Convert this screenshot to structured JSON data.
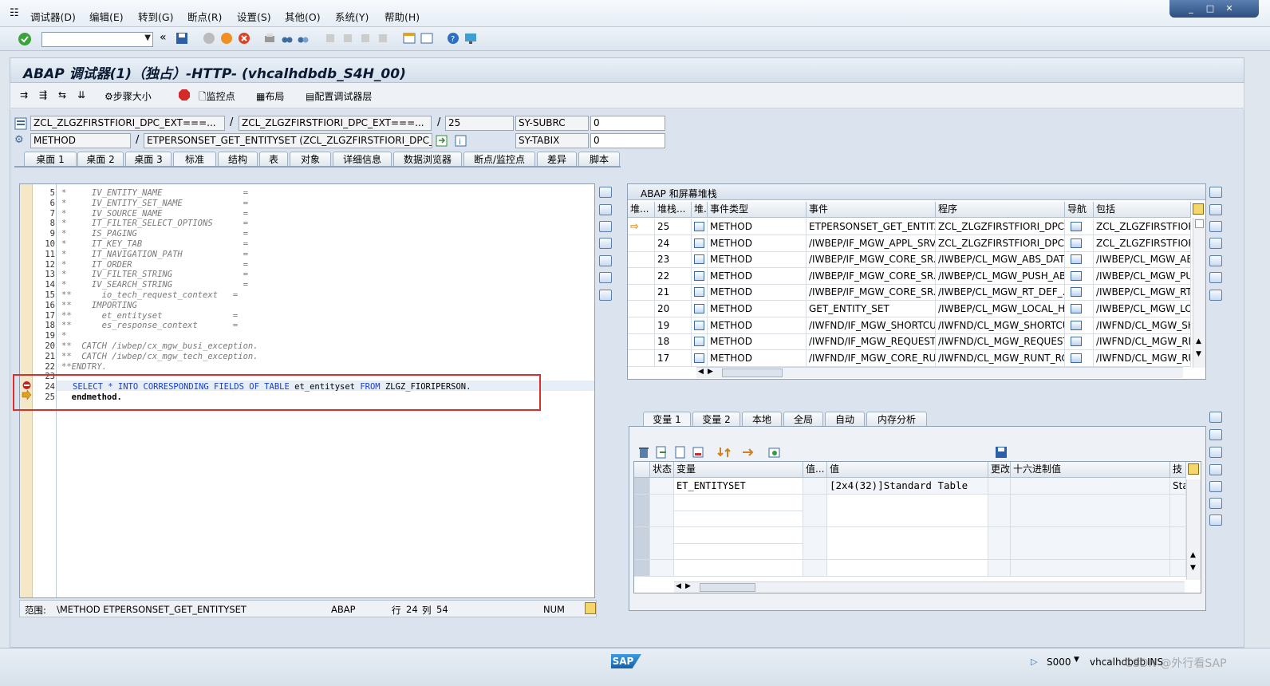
{
  "menu": [
    "调试器(D)",
    "编辑(E)",
    "转到(G)",
    "断点(R)",
    "设置(S)",
    "其他(O)",
    "系统(Y)",
    "帮助(H)"
  ],
  "window_controls": [
    "_",
    "□",
    "✕"
  ],
  "title": "ABAP 调试器(1)（独占）-HTTP- (vhcalhdbdb_S4H_00)",
  "app_toolbar": {
    "step_size": "步骤大小",
    "watchpoint": "监控点",
    "layout": "布局",
    "configure_layers": "配置调试器层"
  },
  "location": {
    "main_program": "ZCL_ZLGZFIRSTFIORI_DPC_EXT===...",
    "include": "ZCL_ZLGZFIRSTFIORI_DPC_EXT===...",
    "line": "25",
    "event_type": "METHOD",
    "event": "ETPERSONSET_GET_ENTITYSET (ZCL_ZLGZFIRSTFIORI_DPC_E...",
    "sysfield1_name": "SY-SUBRC",
    "sysfield1_value": "0",
    "sysfield2_name": "SY-TABIX",
    "sysfield2_value": "0",
    "separator": "/"
  },
  "tabs": [
    "桌面 1",
    "桌面 2",
    "桌面 3",
    "标准",
    "结构",
    "表",
    "对象",
    "详细信息",
    "数据浏览器",
    "断点/监控点",
    "差异",
    "脚本"
  ],
  "active_tab": "标准",
  "code": {
    "lines": [
      {
        "no": "5",
        "text": "*     IV_ENTITY_NAME                =",
        "type": "comment"
      },
      {
        "no": "6",
        "text": "*     IV_ENTITY_SET_NAME            =",
        "type": "comment"
      },
      {
        "no": "7",
        "text": "*     IV_SOURCE_NAME                =",
        "type": "comment"
      },
      {
        "no": "8",
        "text": "*     IT_FILTER_SELECT_OPTIONS      =",
        "type": "comment"
      },
      {
        "no": "9",
        "text": "*     IS_PAGING                     =",
        "type": "comment"
      },
      {
        "no": "10",
        "text": "*     IT_KEY_TAB                    =",
        "type": "comment"
      },
      {
        "no": "11",
        "text": "*     IT_NAVIGATION_PATH            =",
        "type": "comment"
      },
      {
        "no": "12",
        "text": "*     IT_ORDER                      =",
        "type": "comment"
      },
      {
        "no": "13",
        "text": "*     IV_FILTER_STRING              =",
        "type": "comment"
      },
      {
        "no": "14",
        "text": "*     IV_SEARCH_STRING              =",
        "type": "comment"
      },
      {
        "no": "15",
        "text": "**      io_tech_request_context   =",
        "type": "comment"
      },
      {
        "no": "16",
        "text": "**    IMPORTING",
        "type": "comment"
      },
      {
        "no": "17",
        "text": "**      et_entityset              =",
        "type": "comment"
      },
      {
        "no": "18",
        "text": "**      es_response_context       =",
        "type": "comment"
      },
      {
        "no": "19",
        "text": "*",
        "type": "comment"
      },
      {
        "no": "20",
        "text": "**  CATCH /iwbep/cx_mgw_busi_exception.",
        "type": "comment"
      },
      {
        "no": "21",
        "text": "**  CATCH /iwbep/cx_mgw_tech_exception.",
        "type": "comment"
      },
      {
        "no": "22",
        "text": "**ENDTRY.",
        "type": "comment"
      },
      {
        "no": "23",
        "text": "",
        "type": "code"
      },
      {
        "no": "24",
        "text": "",
        "type": "select"
      },
      {
        "no": "25",
        "text": "  endmethod.",
        "type": "end"
      }
    ],
    "select_kw1": "SELECT * INTO CORRESPONDING FIELDS OF TABLE",
    "select_var": " et_entityset ",
    "select_kw2": "FROM",
    "select_tab": " ZLGZ_FIORIPERSON."
  },
  "status": {
    "scope_label": "范围:",
    "scope_value": "\\METHOD ETPERSONSET_GET_ENTITYSET",
    "lang": "ABAP",
    "row_label": "行",
    "row": "24",
    "col_label": "列",
    "col": "54",
    "num": "NUM"
  },
  "stack": {
    "title": "ABAP 和屏幕堆栈",
    "headers": [
      "堆...",
      "堆栈...",
      "堆.",
      "事件类型",
      "事件",
      "程序",
      "导航",
      "包括"
    ],
    "rows": [
      {
        "level": "25",
        "type": "METHOD",
        "event": "ETPERSONSET_GET_ENTIT...",
        "program": "ZCL_ZLGZFIRSTFIORI_DPC_...",
        "include": "ZCL_ZLGZFIRSTFIORI_",
        "current": true
      },
      {
        "level": "24",
        "type": "METHOD",
        "event": "/IWBEP/IF_MGW_APPL_SRV...",
        "program": "ZCL_ZLGZFIRSTFIORI_DPC=...",
        "include": "ZCL_ZLGZFIRSTFIORI_",
        "current": false
      },
      {
        "level": "23",
        "type": "METHOD",
        "event": "/IWBEP/IF_MGW_CORE_SR...",
        "program": "/IWBEP/CL_MGW_ABS_DAT...",
        "include": "/IWBEP/CL_MGW_ABS",
        "current": false
      },
      {
        "level": "22",
        "type": "METHOD",
        "event": "/IWBEP/IF_MGW_CORE_SR...",
        "program": "/IWBEP/CL_MGW_PUSH_AB...",
        "include": "/IWBEP/CL_MGW_PUS",
        "current": false
      },
      {
        "level": "21",
        "type": "METHOD",
        "event": "/IWBEP/IF_MGW_CORE_SR...",
        "program": "/IWBEP/CL_MGW_RT_DEF_...",
        "include": "/IWBEP/CL_MGW_RT_",
        "current": false
      },
      {
        "level": "20",
        "type": "METHOD",
        "event": "GET_ENTITY_SET",
        "program": "/IWBEP/CL_MGW_LOCAL_H...",
        "include": "/IWBEP/CL_MGW_LOC",
        "current": false
      },
      {
        "level": "19",
        "type": "METHOD",
        "event": "/IWFND/IF_MGW_SHORTCU...",
        "program": "/IWFND/CL_MGW_SHORTCU...",
        "include": "/IWFND/CL_MGW_SH",
        "current": false
      },
      {
        "level": "18",
        "type": "METHOD",
        "event": "/IWFND/IF_MGW_REQUEST...",
        "program": "/IWFND/CL_MGW_REQUEST...",
        "include": "/IWFND/CL_MGW_REQ",
        "current": false
      },
      {
        "level": "17",
        "type": "METHOD",
        "event": "/IWFND/IF_MGW_CORE_RU...",
        "program": "/IWFND/CL_MGW_RUNT_RC...",
        "include": "/IWFND/CL_MGW_RU",
        "current": false
      }
    ]
  },
  "var_tabs": [
    "变量 1",
    "变量 2",
    "本地",
    "全局",
    "自动",
    "内存分析"
  ],
  "active_var_tab": "变量 1",
  "vars": {
    "headers": [
      "状态",
      "变量",
      "值...",
      "值",
      "更改",
      "十六进制值",
      "技"
    ],
    "rows": [
      {
        "name": "ET_ENTITYSET",
        "value": "[2x4(32)]Standard Table",
        "tech": "Sta"
      }
    ]
  },
  "footer": {
    "sap": "SAP",
    "system": "S000",
    "host": "vhcalhdbdb",
    "mode": "INS",
    "watermark": "CSDN @外行看SAP"
  }
}
